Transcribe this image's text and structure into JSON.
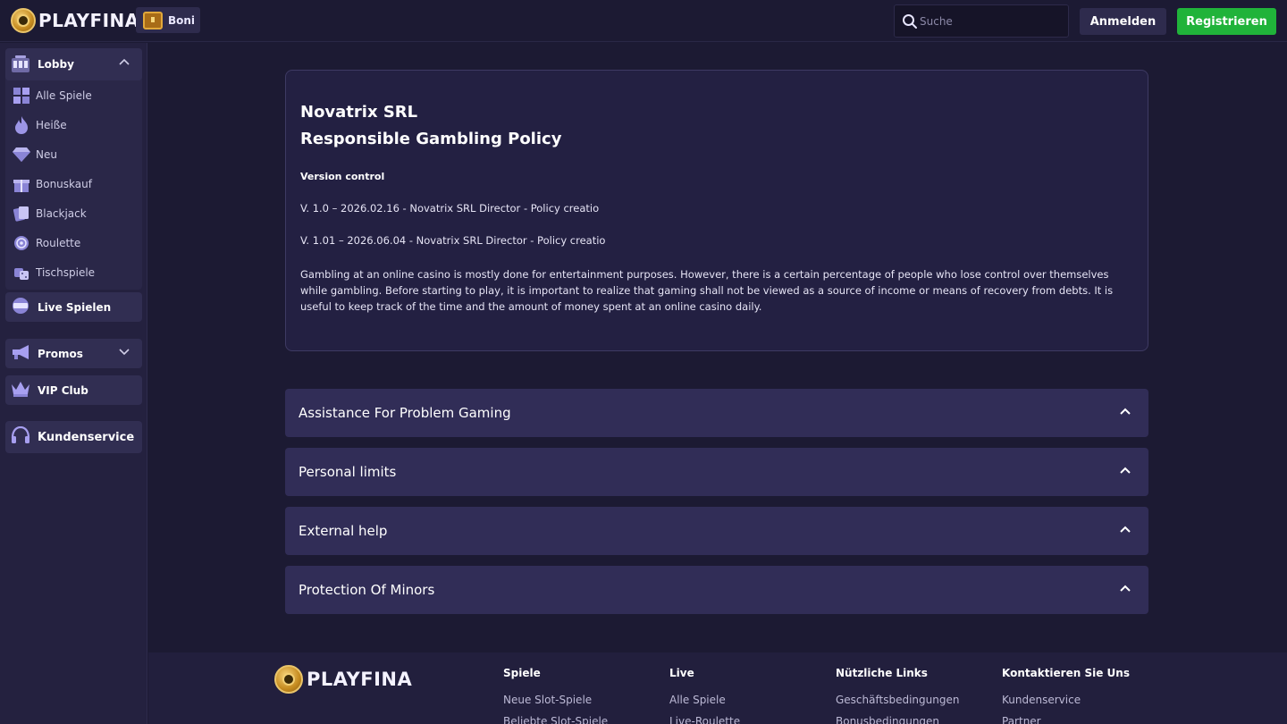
{
  "header": {
    "brand": "PLAYFINA",
    "bonus_label": "Boni",
    "search_placeholder": "Suche",
    "login_label": "Anmelden",
    "register_label": "Registrieren",
    "register_color": "#20b33a"
  },
  "sidebar": {
    "lobby": {
      "label": "Lobby",
      "items": [
        {
          "label": "Alle Spiele",
          "icon": "grid-icon"
        },
        {
          "label": "Heiße",
          "icon": "flame-icon"
        },
        {
          "label": "Neu",
          "icon": "diamond-icon"
        },
        {
          "label": "Bonuskauf",
          "icon": "gift-icon"
        },
        {
          "label": "Blackjack",
          "icon": "cards-icon"
        },
        {
          "label": "Roulette",
          "icon": "roulette-icon"
        },
        {
          "label": "Tischspiele",
          "icon": "dice-icon"
        }
      ]
    },
    "live": {
      "label": "Live Spielen",
      "icon": "live-icon"
    },
    "promos": {
      "label": "Promos",
      "icon": "megaphone-icon"
    },
    "vip": {
      "label": "VIP Club",
      "icon": "crown-icon"
    },
    "support": {
      "label": "Kundenservice",
      "icon": "headset-icon"
    }
  },
  "policy": {
    "title_line1": "Novatrix SRL",
    "title_line2": "Responsible Gambling Policy",
    "version_heading": "Version control",
    "version_1": "V. 1.0 – 2026.02.16 - Novatrix SRL Director - Policy creatio",
    "version_2": "V. 1.01 – 2026.06.04 - Novatrix SRL Director - Policy creatio",
    "paragraph": "Gambling at an online casino is mostly done for entertainment purposes. However, there is a certain percentage of people who lose control over themselves while gambling. Before starting to play, it is important to realize that gaming shall not be viewed as a source of income or means of recovery from debts. It is useful to keep track of the time and the amount of money spent at an online casino daily."
  },
  "accordions": [
    {
      "label": "Assistance For Problem Gaming"
    },
    {
      "label": "Personal limits"
    },
    {
      "label": "External help"
    },
    {
      "label": "Protection Of Minors"
    }
  ],
  "footer": {
    "brand": "PLAYFINA",
    "columns": [
      {
        "heading": "Spiele",
        "links": [
          "Neue Slot-Spiele",
          "Beliebte Slot-Spiele"
        ]
      },
      {
        "heading": "Live",
        "links": [
          "Alle Spiele",
          "Live-Roulette"
        ]
      },
      {
        "heading": "Nützliche Links",
        "links": [
          "Geschäftsbedingungen",
          "Bonusbedingungen"
        ]
      },
      {
        "heading": "Kontaktieren Sie Uns",
        "links": [
          "Kundenservice",
          "Partner"
        ]
      }
    ]
  }
}
